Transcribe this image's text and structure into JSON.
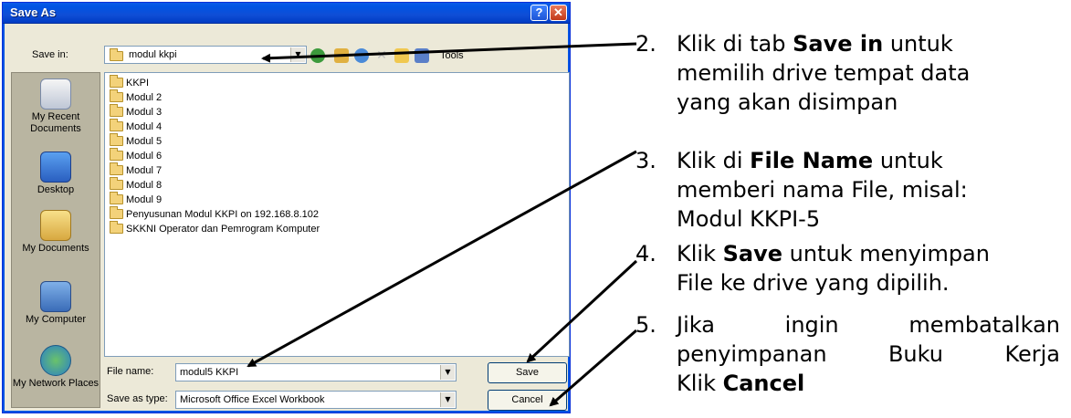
{
  "dialog": {
    "title": "Save As",
    "help_btn": "?",
    "close_btn": "✕",
    "save_in_label": "Save in:",
    "save_in_value": "modul kkpi",
    "tools_label": "Tools",
    "file_name_label": "File name:",
    "file_name_value": "modul5 KKPI",
    "save_as_type_label": "Save as type:",
    "save_as_type_value": "Microsoft Office Excel Workbook",
    "save_button": "Save",
    "cancel_button": "Cancel",
    "places": [
      "My Recent Documents",
      "Desktop",
      "My Documents",
      "My Computer",
      "My Network Places"
    ],
    "folders": [
      "KKPI",
      "Modul 2",
      "Modul 3",
      "Modul 4",
      "Modul 5",
      "Modul 6",
      "Modul 7",
      "Modul 8",
      "Modul 9",
      "Penyusunan Modul KKPI on 192.168.8.102",
      "SKKNI Operator dan Pemrogram Komputer"
    ]
  },
  "instructions": [
    {
      "num": "2.",
      "lines": [
        [
          "Klik di tab ",
          "Save in",
          " untuk"
        ],
        [
          "memilih drive tempat data"
        ],
        [
          "yang akan disimpan"
        ]
      ]
    },
    {
      "num": "3.",
      "lines": [
        [
          "Klik di ",
          "File Name",
          " untuk"
        ],
        [
          "memberi nama File, misal:"
        ],
        [
          "Modul KKPI-5"
        ]
      ]
    },
    {
      "num": "4.",
      "lines": [
        [
          "Klik ",
          "Save",
          " untuk menyimpan"
        ],
        [
          "File ke drive yang dipilih."
        ]
      ]
    },
    {
      "num": "5.",
      "lines": [
        [
          "Jika ingin membatalkan"
        ],
        [
          "penyimpanan Buku Kerja"
        ],
        [
          "Klik ",
          "Cancel"
        ]
      ]
    }
  ],
  "colors": {
    "titlebar": "#0054e3",
    "dialog_bg": "#ece9d8",
    "arrow": "#000000"
  }
}
